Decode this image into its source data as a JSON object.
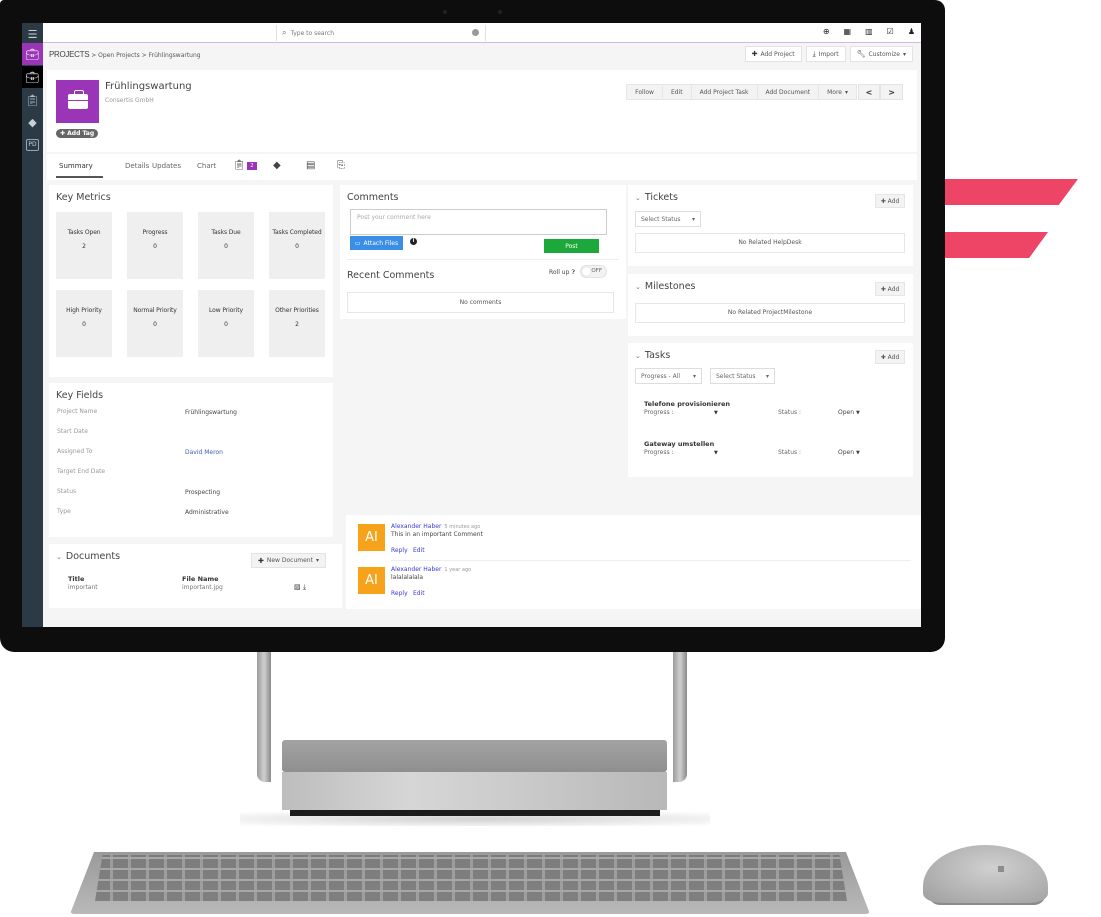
{
  "app": {
    "search": {
      "placeholder": "Type to search"
    },
    "top_icons": [
      "plus-circle-icon",
      "calendar-icon",
      "chart-icon",
      "checkbox-icon",
      "user-icon"
    ],
    "sidebar": {
      "items": [
        {
          "icon": "menu-icon"
        },
        {
          "icon": "briefcase-icon"
        },
        {
          "icon": "briefcase-icon"
        },
        {
          "icon": "clipboard-icon"
        },
        {
          "icon": "diamond-icon"
        },
        {
          "icon": "pd-icon",
          "label": "PD"
        }
      ]
    }
  },
  "breadcrumb": {
    "root": "PROJECTS",
    "separator": ">",
    "items": [
      "Open Projects",
      "Frühlingswartung"
    ]
  },
  "toolbar": {
    "add_project": "Add Project",
    "import": "Import",
    "customize": "Customize"
  },
  "project": {
    "title": "Frühlingswartung",
    "company": "Consertis GmbH",
    "add_tag": "Add Tag",
    "actions": [
      "Follow",
      "Edit",
      "Add Project Task",
      "Add Document",
      "More"
    ],
    "nav_prev": "<",
    "nav_next": ">"
  },
  "tabs": {
    "items": [
      "Summary",
      "Details",
      "Updates",
      "Chart"
    ],
    "active": "Summary",
    "tasks_badge": "2"
  },
  "key_metrics": {
    "title": "Key Metrics",
    "items": [
      {
        "label": "Tasks Open",
        "value": "2"
      },
      {
        "label": "Progress",
        "value": "0"
      },
      {
        "label": "Tasks Due",
        "value": "0"
      },
      {
        "label": "Tasks Completed",
        "value": "0"
      },
      {
        "label": "High Priority",
        "value": "0"
      },
      {
        "label": "Normal Priority",
        "value": "0"
      },
      {
        "label": "Low Priority",
        "value": "0"
      },
      {
        "label": "Other Priorities",
        "value": "2"
      }
    ]
  },
  "key_fields": {
    "title": "Key Fields",
    "rows": [
      {
        "label": "Project Name",
        "value": "Frühlingswartung"
      },
      {
        "label": "Start Date",
        "value": ""
      },
      {
        "label": "Assigned To",
        "value": "David Meron"
      },
      {
        "label": "Target End Date",
        "value": ""
      },
      {
        "label": "Status",
        "value": "Prospecting"
      },
      {
        "label": "Type",
        "value": "Administrative"
      }
    ]
  },
  "documents": {
    "title": "Documents",
    "new_button": "New Document",
    "headers": {
      "title": "Title",
      "file_name": "File Name"
    },
    "rows": [
      {
        "title": "important",
        "file_name": "important.jpg"
      }
    ]
  },
  "comments": {
    "title": "Comments",
    "placeholder": "Post your comment here",
    "attach_label": "Attach Files",
    "post_label": "Post",
    "recent_title": "Recent Comments",
    "rollup_label": "Roll up",
    "rollup_state": "OFF",
    "empty": "No comments",
    "thread": [
      {
        "initials": "AI",
        "author": "Alexander Haber",
        "time": "5 minutes ago",
        "text": "This in an important Comment",
        "reply": "Reply",
        "edit": "Edit"
      },
      {
        "initials": "AI",
        "author": "Alexander Haber",
        "time": "1 year ago",
        "text": "lalalalalala",
        "reply": "Reply",
        "edit": "Edit"
      }
    ]
  },
  "tickets": {
    "title": "Tickets",
    "add_label": "Add",
    "status_select": "Select Status",
    "empty": "No Related HelpDesk"
  },
  "milestones": {
    "title": "Milestones",
    "add_label": "Add",
    "empty": "No Related ProjectMilestone"
  },
  "tasks": {
    "title": "Tasks",
    "add_label": "Add",
    "progress_select": "Progress - All",
    "status_select": "Select Status",
    "progress_label": "Progress :",
    "status_label": "Status :",
    "items": [
      {
        "name": "Telefone provisionieren",
        "status": "Open"
      },
      {
        "name": "Gateway umstellen",
        "status": "Open"
      }
    ]
  },
  "colors": {
    "brand": "#9a35b8",
    "post": "#1ca83a",
    "attach": "#3a8ee6",
    "avatar": "#f7a21b",
    "accent_stripes": "#ee4466"
  }
}
